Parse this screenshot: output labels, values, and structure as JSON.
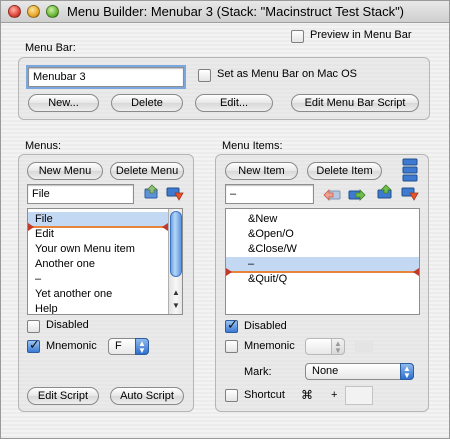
{
  "window": {
    "title": "Menu Builder: Menubar 3 (Stack: \"Macinstruct Test Stack\")"
  },
  "preview": {
    "label": "Preview in Menu Bar",
    "checked": false
  },
  "menubar_group": {
    "title": "Menu Bar:",
    "name_value": "Menubar 3",
    "set_mac_label": "Set as Menu Bar on Mac OS",
    "buttons": {
      "new": "New...",
      "delete": "Delete",
      "edit": "Edit...",
      "edit_script": "Edit Menu Bar Script"
    }
  },
  "menus_group": {
    "title": "Menus:",
    "buttons": {
      "new_menu": "New Menu",
      "delete_menu": "Delete Menu",
      "edit_script": "Edit Script",
      "auto_script": "Auto Script"
    },
    "name_value": "File",
    "items": [
      "File",
      "Edit",
      "Your own Menu item",
      "Another one",
      "–",
      "Yet another one",
      "Help"
    ],
    "selected_index": 0,
    "disabled_label": "Disabled",
    "mnemonic_label": "Mnemonic",
    "mnemonic_value": "F"
  },
  "items_group": {
    "title": "Menu Items:",
    "buttons": {
      "new_item": "New Item",
      "delete_item": "Delete Item"
    },
    "name_value": "–",
    "items": [
      "&New",
      "&Open/O",
      "&Close/W",
      "–",
      "&Quit/Q"
    ],
    "selected_index": 3,
    "disabled_label": "Disabled",
    "mnemonic_label": "Mnemonic",
    "mark_label": "Mark:",
    "mark_value": "None",
    "shortcut_label": "Shortcut",
    "shortcut_cmd": "⌘",
    "shortcut_plus": "+"
  },
  "colors": {
    "selection": "#c3d9f3",
    "drop_indicator": "#e8833a",
    "accent_blue": "#3b7bd6"
  }
}
